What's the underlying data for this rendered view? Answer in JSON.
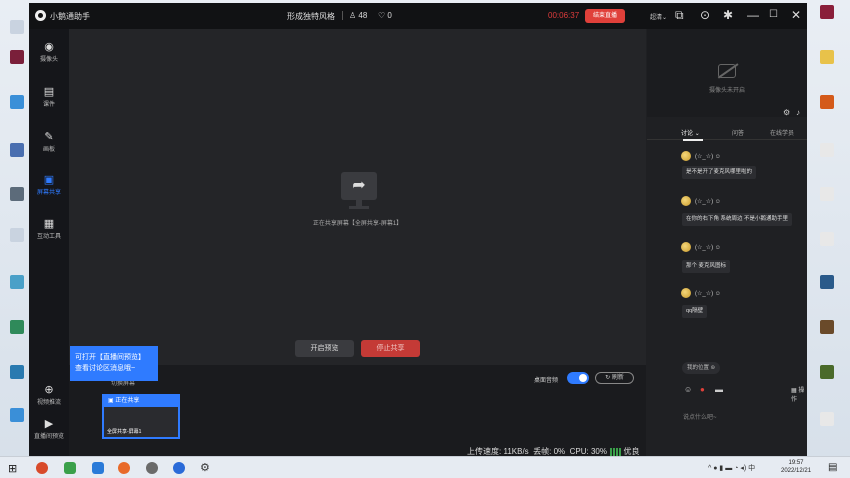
{
  "window": {
    "app_title": "小鹅通助手",
    "course_title": "形成独特风格",
    "viewer_count": "48",
    "like_count": "0",
    "timer": "00:06:37",
    "end_live_label": "结束直播",
    "more_menu_label": "超清",
    "more_menu_arrow": "⌄"
  },
  "sidebar": {
    "items": [
      {
        "label": "摄像头",
        "icon": "camera-icon",
        "glyph": "◉"
      },
      {
        "label": "课件",
        "icon": "courseware-icon",
        "glyph": "▤"
      },
      {
        "label": "画板",
        "icon": "palette-icon",
        "glyph": "✎"
      },
      {
        "label": "屏幕共享",
        "icon": "screen-share-icon",
        "glyph": "▣"
      },
      {
        "label": "互动工具",
        "icon": "toolbox-icon",
        "glyph": "▦"
      },
      {
        "label": "视频推流",
        "icon": "stream-icon",
        "glyph": "⊕"
      },
      {
        "label": "直播间预览",
        "icon": "preview-icon",
        "glyph": "▶"
      }
    ],
    "active_index": 3
  },
  "stage": {
    "sharing_text": "正在共享屏幕【全屏共享-屏幕1】",
    "preview_button": "开启预览",
    "stop_share_button": "停止共享"
  },
  "tip": {
    "line1": "可打开【直播间预览】",
    "line2": "查看讨论区消息哦~"
  },
  "bottom": {
    "hidden_tab": "切换屏幕",
    "desktop_audio_label": "桌面音频",
    "desktop_audio_on": true,
    "refresh_label": "刷新",
    "thumb_header": "正在共享",
    "thumb_caption": "全屏共享-屏幕1",
    "status": {
      "upload_label": "上传速度:",
      "upload_value": "11KB/s",
      "drop_label": "丢帧:",
      "drop_value": "0%",
      "cpu_label": "CPU:",
      "cpu_value": "30%",
      "quality": "优良"
    }
  },
  "right_panel": {
    "camera_off_text": "摄像头未开启",
    "tabs": [
      "讨论",
      "问答",
      "在线学员"
    ],
    "tab_arrow": "⌄",
    "messages": [
      {
        "user": "(☆_☆)",
        "text": "是不是开了麦克风哪里啦的"
      },
      {
        "user": "(☆_☆)",
        "text": "在你的右下角 系统周边 不是小鹅通助手里"
      },
      {
        "user": "(☆_☆)",
        "text": "那个 麦克风图标"
      },
      {
        "user": "(☆_☆)",
        "text": "qq隔壁"
      }
    ],
    "my_position_label": "我的位置",
    "operations_label": "操作",
    "input_placeholder": "说点什么吧~",
    "ask_label": "提问",
    "send_label": "发送"
  },
  "taskbar": {
    "time": "19:57",
    "date": "2022/12/21",
    "lang": "中"
  },
  "colors": {
    "accent": "#2f7bff",
    "danger": "#e0403a",
    "window_bg": "#1f2023"
  }
}
